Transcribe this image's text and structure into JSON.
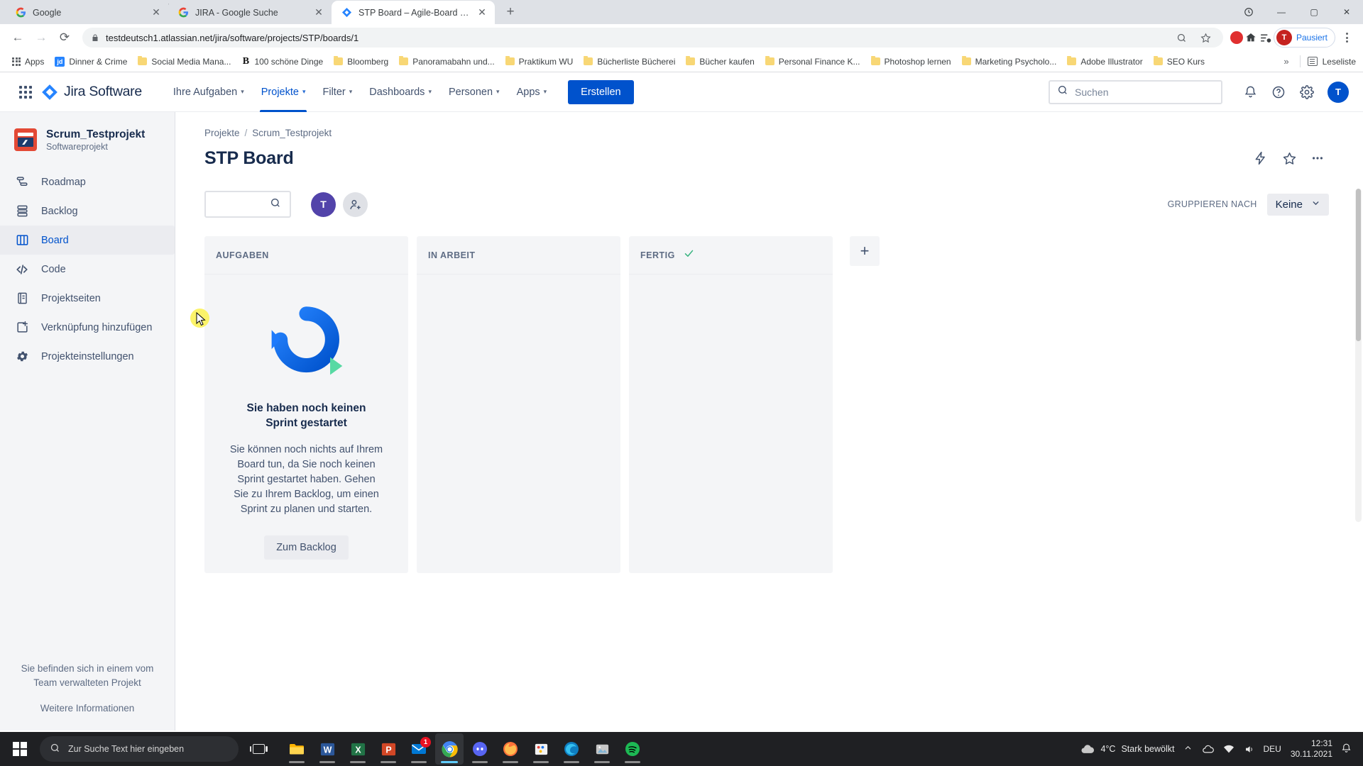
{
  "browser": {
    "tabs": [
      {
        "title": "Google",
        "favicon": "google-icon",
        "active": false
      },
      {
        "title": "JIRA - Google Suche",
        "favicon": "google-icon",
        "active": false
      },
      {
        "title": "STP Board – Agile-Board - Jira",
        "favicon": "jira-icon",
        "active": true
      }
    ],
    "new_tab_label": "+",
    "window_controls": {
      "minimize": "—",
      "maximize": "▢",
      "close": "✕"
    },
    "nav": {
      "back": "←",
      "forward": "→",
      "reload": "⟳"
    },
    "omnibox": {
      "url": "testdeutsch1.atlassian.net/jira/software/projects/STP/boards/1",
      "lock_icon": "lock-icon",
      "zoom_icon": "search-zoom-icon",
      "bookmark_icon": "star-icon"
    },
    "profile": {
      "initial": "T",
      "label": "Pausiert"
    },
    "bookmarks": [
      {
        "label": "Apps",
        "icon": "apps-grid-icon"
      },
      {
        "label": "Dinner & Crime",
        "icon": "jd-icon"
      },
      {
        "label": "Social Media Mana...",
        "icon": "folder-icon"
      },
      {
        "label": "100 schöne Dinge",
        "icon": "b-icon"
      },
      {
        "label": "Bloomberg",
        "icon": "folder-icon"
      },
      {
        "label": "Panoramabahn und...",
        "icon": "folder-icon"
      },
      {
        "label": "Praktikum WU",
        "icon": "folder-icon"
      },
      {
        "label": "Bücherliste Bücherei",
        "icon": "folder-icon"
      },
      {
        "label": "Bücher kaufen",
        "icon": "folder-icon"
      },
      {
        "label": "Personal Finance K...",
        "icon": "folder-icon"
      },
      {
        "label": "Photoshop lernen",
        "icon": "folder-icon"
      },
      {
        "label": "Marketing Psycholo...",
        "icon": "folder-icon"
      },
      {
        "label": "Adobe Illustrator",
        "icon": "folder-icon"
      },
      {
        "label": "SEO Kurs",
        "icon": "folder-icon"
      }
    ],
    "bookmarks_overflow": "»",
    "reading_list": "Leseliste"
  },
  "topnav": {
    "product_name": "Jira Software",
    "items": [
      {
        "label": "Ihre Aufgaben",
        "has_chevron": true,
        "active": false
      },
      {
        "label": "Projekte",
        "has_chevron": true,
        "active": true
      },
      {
        "label": "Filter",
        "has_chevron": true,
        "active": false
      },
      {
        "label": "Dashboards",
        "has_chevron": true,
        "active": false
      },
      {
        "label": "Personen",
        "has_chevron": true,
        "active": false
      },
      {
        "label": "Apps",
        "has_chevron": true,
        "active": false
      }
    ],
    "create_button": "Erstellen",
    "search_placeholder": "Suchen",
    "avatar_initial": "T"
  },
  "sidebar": {
    "project": {
      "name": "Scrum_Testprojekt",
      "type": "Softwareprojekt"
    },
    "items": [
      {
        "label": "Roadmap",
        "icon": "roadmap-icon",
        "active": false
      },
      {
        "label": "Backlog",
        "icon": "backlog-icon",
        "active": false
      },
      {
        "label": "Board",
        "icon": "board-icon",
        "active": true
      },
      {
        "label": "Code",
        "icon": "code-icon",
        "active": false
      },
      {
        "label": "Projektseiten",
        "icon": "pages-icon",
        "active": false
      },
      {
        "label": "Verknüpfung hinzufügen",
        "icon": "add-shortcut-icon",
        "active": false
      },
      {
        "label": "Projekteinstellungen",
        "icon": "gear-icon",
        "active": false
      }
    ],
    "footer_text": "Sie befinden sich in einem vom Team verwalteten Projekt",
    "footer_link": "Weitere Informationen"
  },
  "board": {
    "breadcrumb": [
      "Projekte",
      "Scrum_Testprojekt"
    ],
    "breadcrumb_separator": "/",
    "title": "STP Board",
    "search_placeholder": "",
    "avatars": [
      {
        "initial": "T",
        "color": "#5243aa"
      }
    ],
    "add_people_icon": "add-person-icon",
    "group_by_label": "GRUPPIEREN NACH",
    "group_by_value": "Keine",
    "columns": [
      {
        "title": "AUFGABEN",
        "done": false
      },
      {
        "title": "IN ARBEIT",
        "done": false
      },
      {
        "title": "FERTIG",
        "done": true
      }
    ],
    "add_column_label": "+",
    "empty_state": {
      "title": "Sie haben noch keinen Sprint gestartet",
      "description": "Sie können noch nichts auf Ihrem Board tun, da Sie noch keinen Sprint gestartet haben. Gehen Sie zu Ihrem Backlog, um einen Sprint zu planen und starten.",
      "button": "Zum Backlog"
    }
  },
  "taskbar": {
    "search_placeholder": "Zur Suche Text hier eingeben",
    "apps": [
      {
        "name": "file-explorer",
        "running": true
      },
      {
        "name": "word",
        "running": true
      },
      {
        "name": "excel",
        "running": true
      },
      {
        "name": "powerpoint",
        "running": true
      },
      {
        "name": "mail",
        "running": true,
        "badge": "1"
      },
      {
        "name": "chrome",
        "running": true,
        "active": true
      },
      {
        "name": "discord",
        "running": true
      },
      {
        "name": "firefox",
        "running": true
      },
      {
        "name": "paint",
        "running": true
      },
      {
        "name": "edge",
        "running": true
      },
      {
        "name": "photos",
        "running": true
      },
      {
        "name": "spotify",
        "running": true
      }
    ],
    "weather": {
      "temp": "4°C",
      "desc": "Stark bewölkt"
    },
    "language": "DEU",
    "clock": {
      "time": "12:31",
      "date": "30.11.2021"
    }
  },
  "colors": {
    "jira_blue": "#0052cc",
    "sidebar_bg": "#f4f5f7",
    "text_dark": "#172b4d",
    "text_muted": "#5e6c84",
    "done_green": "#36b37e",
    "project_avatar": "#e34935"
  }
}
